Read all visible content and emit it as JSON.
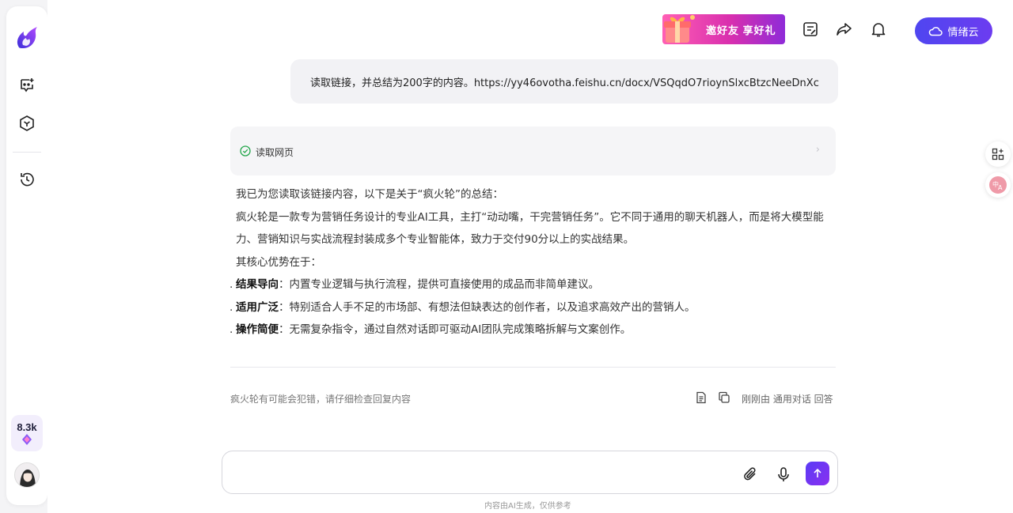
{
  "sidebar": {
    "points_value": "8.3k"
  },
  "header": {
    "invite_label": "邀好友 享好礼",
    "cloud_label": "情绪云"
  },
  "chat": {
    "user_message": "读取链接，并总结为200字的内容。https://yy46ovotha.feishu.cn/docx/VSQqdO7rioynSlxcBtzcNeeDnXc",
    "tool_label": "读取网页",
    "answer_intro": "我已为您读取该链接内容，以下是关于“疯火轮”的总结：",
    "answer_para": "疯火轮是一款专为营销任务设计的专业AI工具，主打“动动嘴，干完营销任务”。它不同于通用的聊天机器人，而是将大模型能力、营销知识与实战流程封装成多个专业智能体，致力于交付90分以上的实战结果。",
    "answer_lead": "其核心优势在于：",
    "bullets": [
      {
        "title": "结果导向",
        "text": "：内置专业逻辑与执行流程，提供可直接使用的成品而非简单建议。"
      },
      {
        "title": "适用广泛",
        "text": "：特别适合人手不足的市场部、有想法但缺表达的创作者，以及追求高效产出的营销人。"
      },
      {
        "title": "操作简便",
        "text": "：无需复杂指令，通过自然对话即可驱动AI团队完成策略拆解与文案创作。"
      }
    ],
    "disclaimer": "疯火轮有可能会犯错，请仔细检查回复内容",
    "reply_meta": "刚刚由 通用对话 回答"
  },
  "composer": {
    "value": "",
    "placeholder": "",
    "ai_note": "内容由AI生成，仅供参考"
  },
  "colors": {
    "accent": "#5b4cf0",
    "success": "#22a64a"
  }
}
